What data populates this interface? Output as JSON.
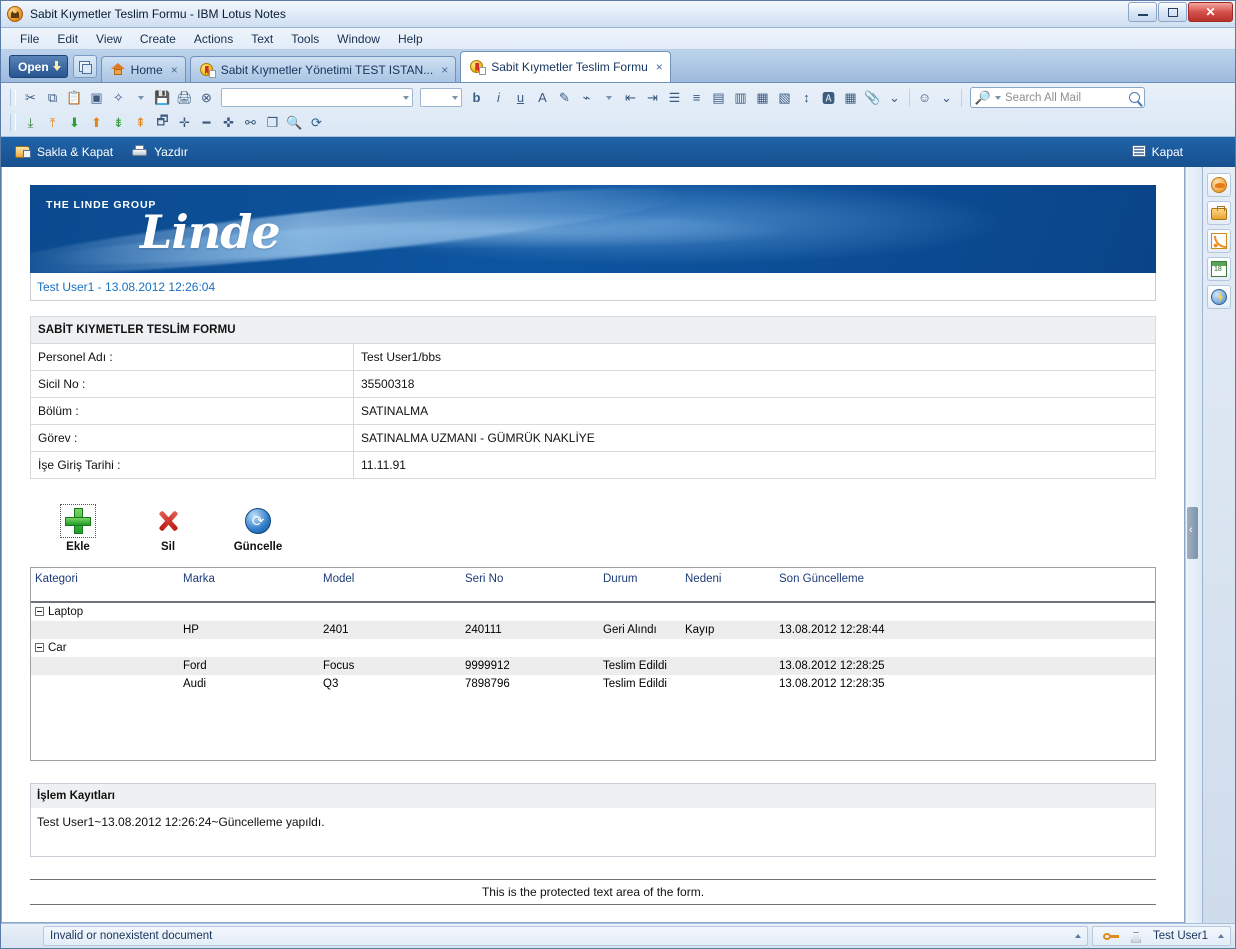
{
  "window": {
    "title": "Sabit Kıymetler Teslim Formu - IBM Lotus Notes",
    "app_icon": "lotus-notes-icon",
    "minimize": "–",
    "maximize": "□",
    "close": "✕"
  },
  "menu": {
    "items": [
      "File",
      "Edit",
      "View",
      "Create",
      "Actions",
      "Text",
      "Tools",
      "Window",
      "Help"
    ]
  },
  "tabbar": {
    "open_label": "Open",
    "tabs": [
      {
        "label": "Home",
        "icon": "home-icon",
        "close": "×",
        "active": false
      },
      {
        "label": "Sabit Kıymetler Yönetimi TEST ISTAN...",
        "icon": "database-icon",
        "close": "×",
        "active": false
      },
      {
        "label": "Sabit Kıymetler Teslim Formu",
        "icon": "document-icon",
        "close": "×",
        "active": true
      }
    ]
  },
  "toolbar": {
    "row1_icons": [
      "cut-icon",
      "copy-icon",
      "paste-icon",
      "paste-special-icon",
      "new-icon",
      "save-icon",
      "print-icon",
      "cancel-icon"
    ],
    "font_value": "",
    "size_value": "",
    "format_icons": [
      "bold-icon",
      "italic-icon",
      "underline-icon",
      "font-color-icon",
      "highlight-icon",
      "text-style-icon"
    ],
    "paragraph_icons": [
      "outdent-icon",
      "indent-icon",
      "bullet-list-icon",
      "numbered-list-icon",
      "align-left-icon",
      "align-justify-icon",
      "align-center-icon",
      "align-right-icon",
      "line-spacing-icon",
      "spellcheck-icon",
      "table-icon",
      "attach-icon"
    ],
    "row2_icons": [
      "import-icon",
      "export-icon",
      "move-down-icon",
      "move-up-icon",
      "refresh-down-icon",
      "refresh-up-icon",
      "open-window-icon",
      "add-icon",
      "remove-icon",
      "insert-icon",
      "link-icon",
      "duplicate-icon",
      "find-icon",
      "reload-icon"
    ],
    "search_placeholder": "Search All Mail",
    "search_value": "",
    "search_icon": "magnifier-icon"
  },
  "actionbar": {
    "save_close": "Sakla & Kapat",
    "print": "Yazdır",
    "close": "Kapat"
  },
  "sidebar": {
    "items": [
      {
        "name": "chat-icon"
      },
      {
        "name": "briefcase-icon"
      },
      {
        "name": "feeds-icon"
      },
      {
        "name": "calendar-icon"
      },
      {
        "name": "activities-icon"
      }
    ]
  },
  "document": {
    "banner": {
      "group_text": "THE LINDE GROUP",
      "wordmark": "Linde"
    },
    "user_line": "Test User1 - 13.08.2012 12:26:04",
    "form_title": "SABİT KIYMETLER TESLİM FORMU",
    "fields": [
      {
        "label": "Personel Adı :",
        "value": "Test User1/bbs"
      },
      {
        "label": "Sicil No :",
        "value": "35500318"
      },
      {
        "label": "Bölüm :",
        "value": "SATINALMA"
      },
      {
        "label": "Görev :",
        "value": "SATINALMA UZMANI - GÜMRÜK NAKLİYE"
      },
      {
        "label": "İşe Giriş Tarihi :",
        "value": "11.11.91"
      }
    ],
    "operations": [
      {
        "label": "Ekle",
        "icon": "plus-icon"
      },
      {
        "label": "Sil",
        "icon": "delete-x-icon"
      },
      {
        "label": "Güncelle",
        "icon": "refresh-icon"
      }
    ],
    "grid": {
      "columns": [
        "Kategori",
        "Marka",
        "Model",
        "Seri No",
        "Durum",
        "Nedeni",
        "Son Güncelleme"
      ],
      "groups": [
        {
          "name": "Laptop",
          "rows": [
            {
              "kategori": "",
              "marka": "HP",
              "model": "2401",
              "seri_no": "240111",
              "durum": "Geri Alındı",
              "nedeni": "Kayıp",
              "son_guncelleme": "13.08.2012 12:28:44"
            }
          ]
        },
        {
          "name": "Car",
          "rows": [
            {
              "kategori": "",
              "marka": "Ford",
              "model": "Focus",
              "seri_no": "9999912",
              "durum": "Teslim Edildi",
              "nedeni": "",
              "son_guncelleme": "13.08.2012 12:28:25"
            },
            {
              "kategori": "",
              "marka": "Audi",
              "model": "Q3",
              "seri_no": "7898796",
              "durum": "Teslim Edildi",
              "nedeni": "",
              "son_guncelleme": "13.08.2012 12:28:35"
            }
          ]
        }
      ]
    },
    "logs_title": "İşlem Kayıtları",
    "logs_entry": "Test User1~13.08.2012 12:26:24~Güncelleme yapıldı.",
    "protected_text": "This is the protected text area of the form."
  },
  "statusbar": {
    "message": "Invalid or nonexistent document",
    "user": "Test User1"
  },
  "colors": {
    "accent_blue": "#1f63a9",
    "linde_blue": "#0d55a0",
    "link_blue": "#1a6fbf",
    "grid_header": "#1c3c78"
  }
}
